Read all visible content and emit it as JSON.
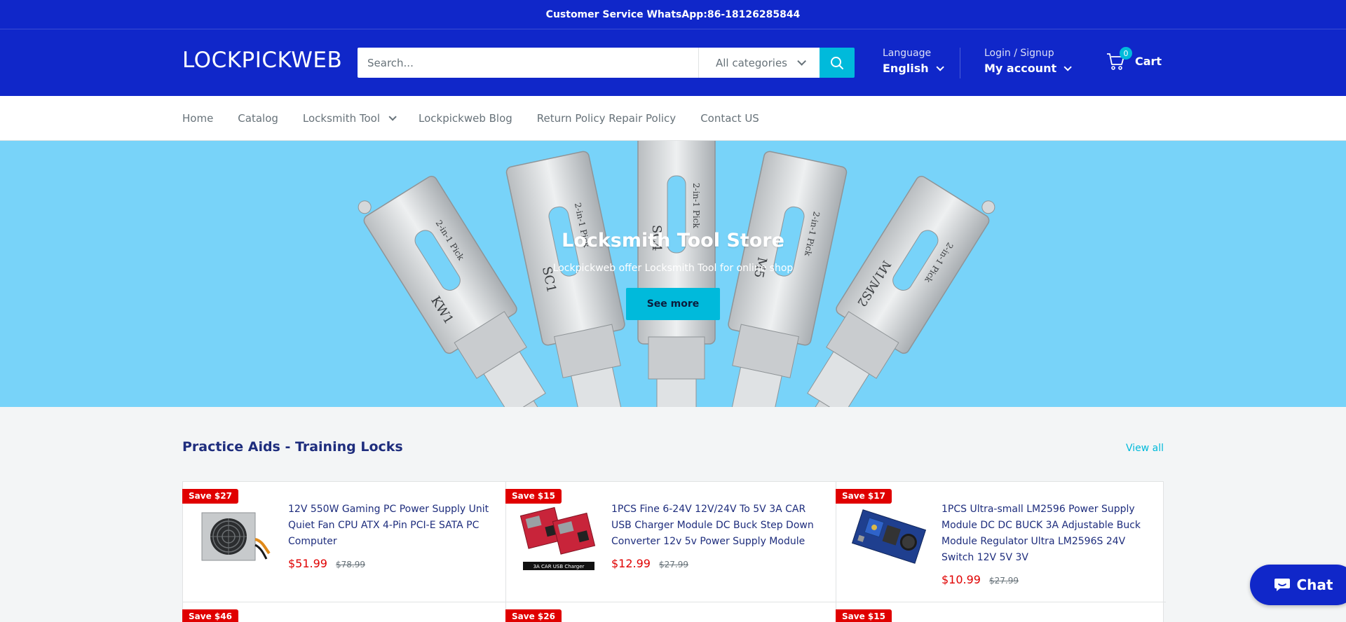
{
  "announcement": "Customer Service WhatsApp:86-18126285844",
  "header": {
    "logo": "LOCKPICKWEB",
    "search": {
      "placeholder": "Search...",
      "category": "All categories"
    },
    "language": {
      "label": "Language",
      "value": "English"
    },
    "account": {
      "label": "Login / Signup",
      "value": "My account"
    },
    "cart": {
      "count": "0",
      "label": "Cart"
    }
  },
  "nav": {
    "items": [
      {
        "label": "Home"
      },
      {
        "label": "Catalog"
      },
      {
        "label": "Locksmith Tool"
      },
      {
        "label": "Lockpickweb Blog"
      },
      {
        "label": "Return Policy Repair Policy"
      },
      {
        "label": "Contact US"
      }
    ]
  },
  "hero": {
    "title": "Locksmith Tool Store",
    "subtitle": "Lockpickweb offer Locksmith Tool for online shop",
    "button": "See more",
    "pick_labels": [
      "KW1",
      "2-in-1 Pick",
      "SC1",
      "2-in-1 Pick",
      "SC4",
      "2-in-1 Pick",
      "M5",
      "2-in-1 Pick",
      "M1/MS2",
      "2-in-1 Pick"
    ]
  },
  "section": {
    "title": "Practice Aids - Training Locks",
    "view_all": "View all",
    "products": [
      {
        "badge": "Save $27",
        "title": "12V 550W Gaming PC Power Supply Unit Quiet Fan CPU ATX 4-Pin PCI-E SATA PC Computer",
        "price": "$51.99",
        "compare": "$78.99"
      },
      {
        "badge": "Save $15",
        "title": "1PCS Fine 6-24V 12V/24V To 5V 3A CAR USB Charger Module DC Buck Step Down Converter 12v 5v Power Supply Module",
        "price": "$12.99",
        "compare": "$27.99",
        "image_caption": "3A CAR USB Charger"
      },
      {
        "badge": "Save $17",
        "title": "1PCS Ultra-small LM2596 Power Supply Module DC DC BUCK 3A Adjustable Buck Module Regulator Ultra LM2596S 24V Switch 12V 5V 3V",
        "price": "$10.99",
        "compare": "$27.99"
      }
    ],
    "next_row_badges": [
      "Save $46",
      "Save $26",
      "Save $15"
    ]
  },
  "chat": {
    "label": "Chat"
  },
  "colors": {
    "primary": "#1027c9",
    "accent": "#00badb",
    "hero_bg": "#78d3f9",
    "sale": "#e00000"
  }
}
